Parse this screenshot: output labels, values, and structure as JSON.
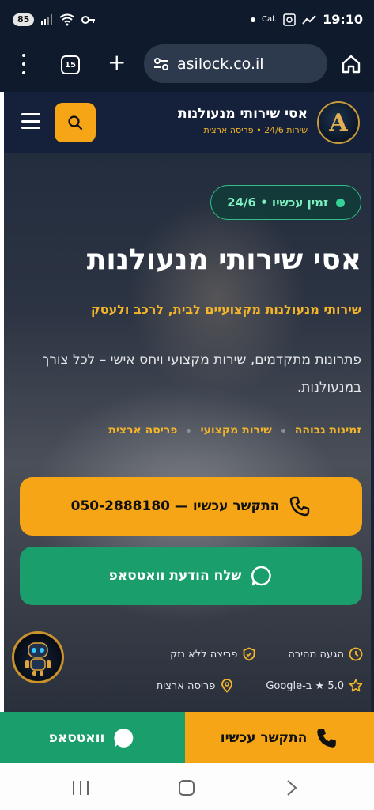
{
  "status_bar": {
    "battery": "85",
    "time": "19:10",
    "carrier_label": "Cal."
  },
  "browser": {
    "tab_count": "15",
    "url": "asilock.co.il"
  },
  "site_header": {
    "logo_letter": "A",
    "title": "אסי שירותי מנעולנות",
    "subtitle": "שירות 24/6 • פריסה ארצית"
  },
  "hero": {
    "badge": "זמין עכשיו • 24/6",
    "title": "אסי שירותי מנעולנות",
    "subtitle": "שירותי מנעולנות מקצועיים לבית, לרכב ולעסק",
    "description": "פתרונות מתקדמים, שירות מקצועי ויחס אישי – לכל צורך במנעולנות.",
    "features": [
      "זמינות גבוהה",
      "שירות מקצועי",
      "פריסה ארצית"
    ]
  },
  "cta": {
    "call_label": "התקשר עכשיו — 050-2888180",
    "whatsapp_label": "שלח הודעת וואטסאפ"
  },
  "trust": {
    "row1": [
      "הגעה מהירה",
      "פריצה ללא נזק"
    ],
    "row2": [
      "5.0 ★ ב-Google",
      "פריסה ארצית"
    ]
  },
  "sticky": {
    "call_label": "התקשר עכשיו",
    "whatsapp_label": "וואטסאפ"
  },
  "colors": {
    "accent": "#f5a516",
    "whatsapp": "#1a9e6c",
    "header_bg": "#15213a"
  }
}
